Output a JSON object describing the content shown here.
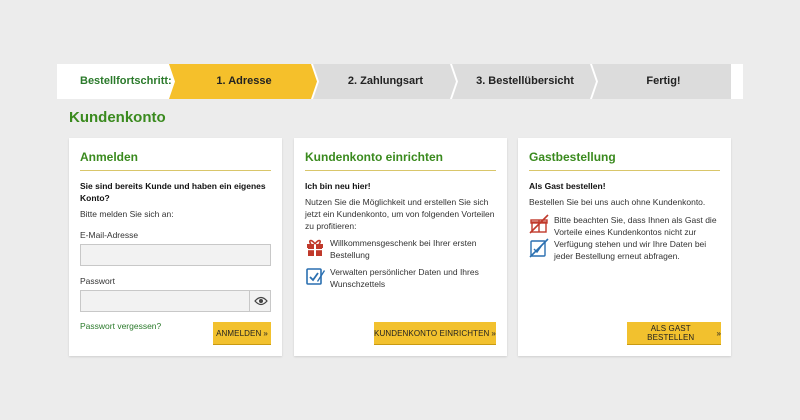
{
  "progress": {
    "label": "Bestellfortschritt:",
    "steps": [
      {
        "label": "1. Adresse",
        "active": true
      },
      {
        "label": "2. Zahlungsart",
        "active": false
      },
      {
        "label": "3. Bestellübersicht",
        "active": false
      },
      {
        "label": "Fertig!",
        "active": false
      }
    ],
    "colors": {
      "active": "#f5c02b",
      "inactive": "#dcdcdc"
    }
  },
  "page": {
    "title": "Kundenkonto"
  },
  "login": {
    "title": "Anmelden",
    "heading": "Sie sind bereits Kunde und haben ein eigenes Konto?",
    "subtext": "Bitte melden Sie sich an:",
    "email_label": "E-Mail-Adresse",
    "email_value": "",
    "password_label": "Passwort",
    "password_value": "",
    "forgot_link": "Passwort vergessen?",
    "button": "ANMELDEN",
    "eye_icon": "eye-icon"
  },
  "register": {
    "title": "Kundenkonto einrichten",
    "heading": "Ich bin neu hier!",
    "text": "Nutzen Sie die Möglichkeit und erstellen Sie sich jetzt ein Kundenkonto, um von folgenden Vorteilen zu profitieren:",
    "benefits": [
      {
        "icon": "gift-icon",
        "text": "Willkommensgeschenk bei Ihrer ersten Bestellung"
      },
      {
        "icon": "edit-checklist-icon",
        "text": "Verwalten persönlicher Daten und Ihres Wunschzettels"
      }
    ],
    "button": "KUNDENKONTO EINRICHTEN"
  },
  "guest": {
    "title": "Gastbestellung",
    "heading": "Als Gast bestellen!",
    "text": "Bestellen Sie bei uns auch ohne Kundenkonto.",
    "notice": "Bitte beachten Sie, dass Ihnen als Gast die Vorteile eines Kundenkontos nicht zur Verfügung stehen und wir Ihre Daten bei jeder Bestellung erneut abfragen.",
    "icons": [
      "no-gift-icon",
      "no-edit-icon"
    ],
    "button": "ALS GAST BESTELLEN"
  },
  "colors": {
    "brand_green": "#3a8a1e",
    "button_yellow": "#f2c12e",
    "icon_red": "#c0392b",
    "icon_blue": "#2a6fb0"
  }
}
